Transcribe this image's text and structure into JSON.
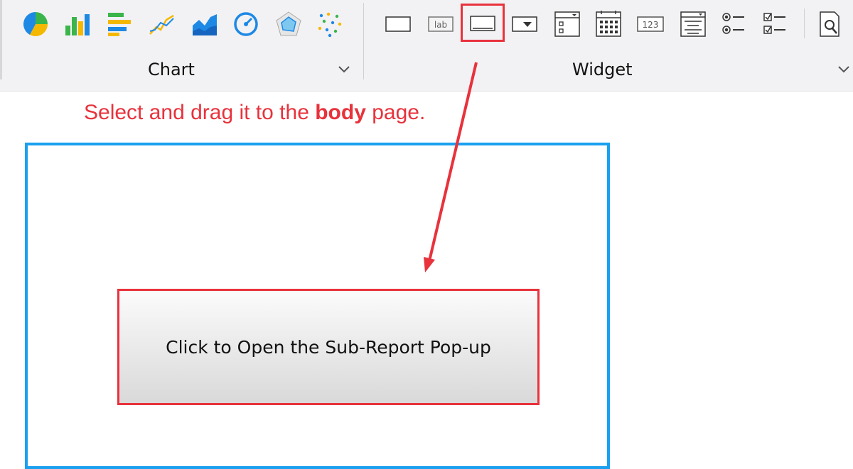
{
  "ribbon": {
    "chart_group_label": "Chart",
    "widget_group_label": "Widget",
    "chart_icons": [
      "pie-chart-icon",
      "bar-chart-icon",
      "horizontal-bar-chart-icon",
      "line-chart-icon",
      "area-chart-icon",
      "gauge-chart-icon",
      "radar-chart-icon",
      "scatter-chart-icon"
    ],
    "widget_icons": {
      "label_text": "lab",
      "number_text": "123",
      "items": [
        "text-box-widget-icon",
        "label-widget-icon",
        "button-widget-icon",
        "dropdown-widget-icon",
        "dropdown-tree-widget-icon",
        "calendar-widget-icon",
        "number-widget-icon",
        "list-box-widget-icon",
        "radio-group-widget-icon",
        "checkbox-group-widget-icon",
        "preview-icon"
      ]
    }
  },
  "annotation": {
    "instruction_prefix": "Select and drag it to the ",
    "instruction_bold": "body",
    "instruction_suffix": " page.",
    "color": "#e8323c"
  },
  "canvas": {
    "button_label": "Click to Open the Sub-Report Pop-up",
    "border_color": "#1aa0ef"
  }
}
